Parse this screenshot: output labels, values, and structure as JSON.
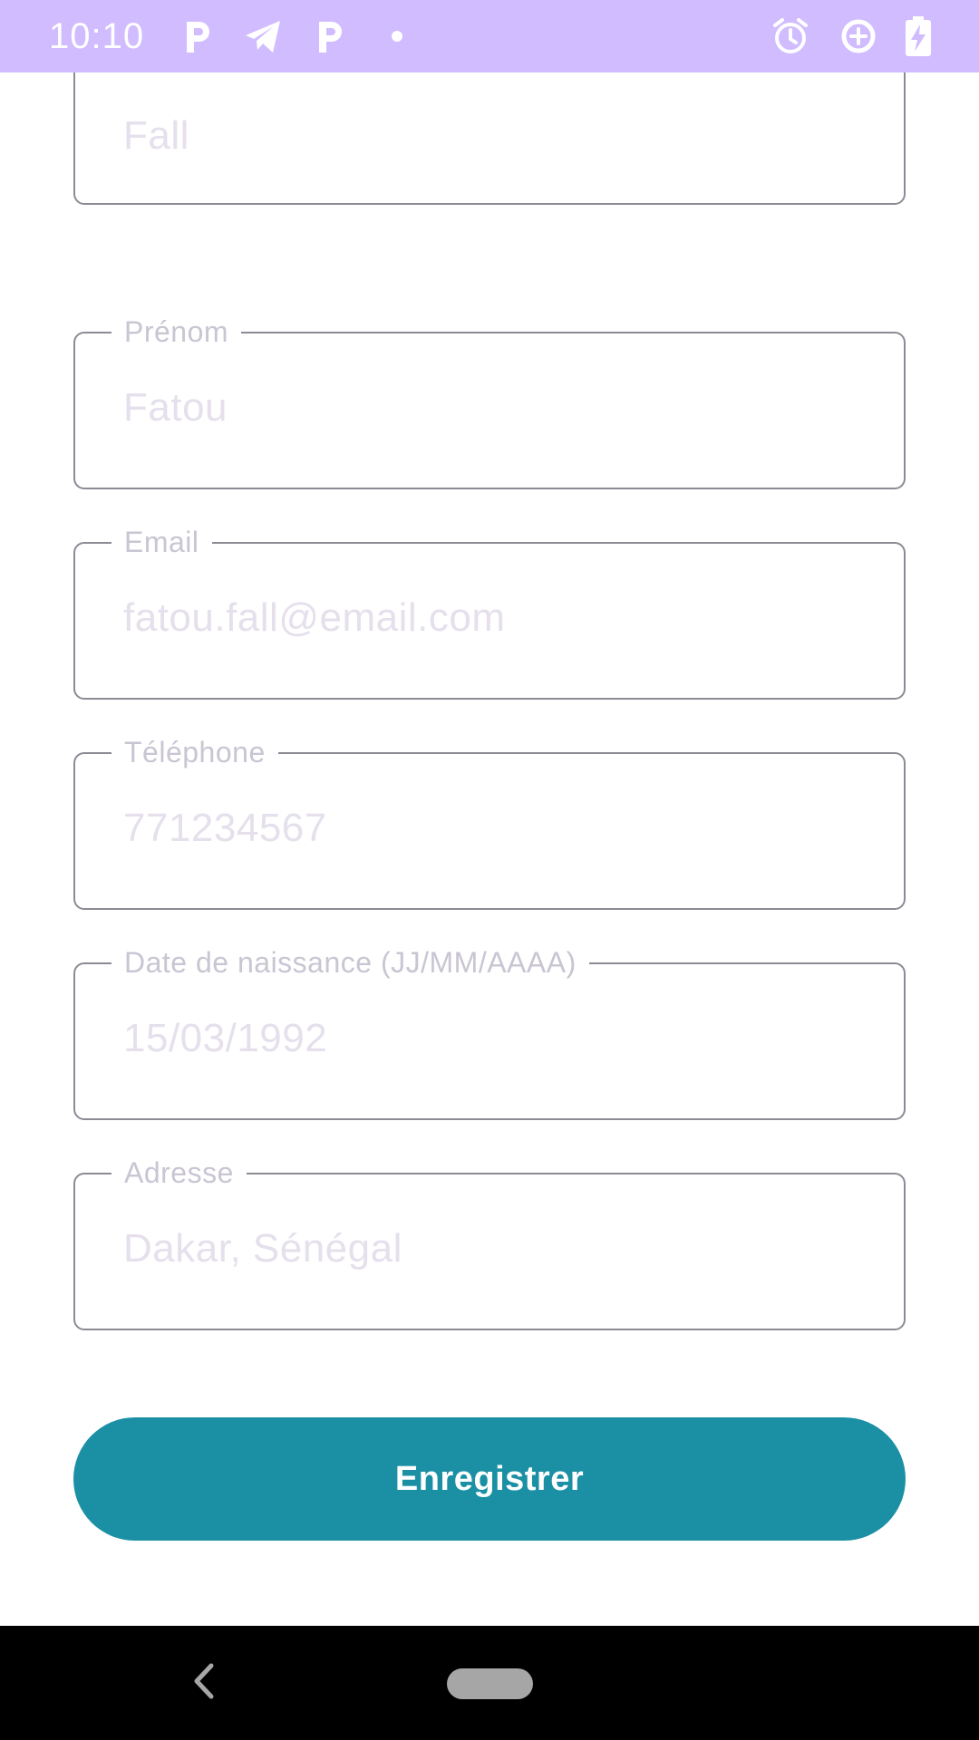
{
  "status_bar": {
    "time": "10:10",
    "bg_color": "#d0bcff",
    "left_icons": [
      "parking-icon",
      "telegram-icon",
      "parking-icon",
      "dot-icon"
    ],
    "right_icons": [
      "alarm-icon",
      "data-saver-icon",
      "battery-charging-icon"
    ]
  },
  "form": {
    "fields": [
      {
        "label": "",
        "value": "Fall"
      },
      {
        "label": "Prénom",
        "value": "Fatou"
      },
      {
        "label": "Email",
        "value": "fatou.fall@email.com"
      },
      {
        "label": "Téléphone",
        "value": "771234567"
      },
      {
        "label": "Date de naissance (JJ/MM/AAAA)",
        "value": "15/03/1992"
      },
      {
        "label": "Adresse",
        "value": "Dakar, Sénégal"
      }
    ],
    "submit_label": "Enregistrer",
    "accent_color": "#1b90a5"
  },
  "nav_bar": {
    "icons": [
      "back-icon",
      "home-pill-icon"
    ]
  }
}
